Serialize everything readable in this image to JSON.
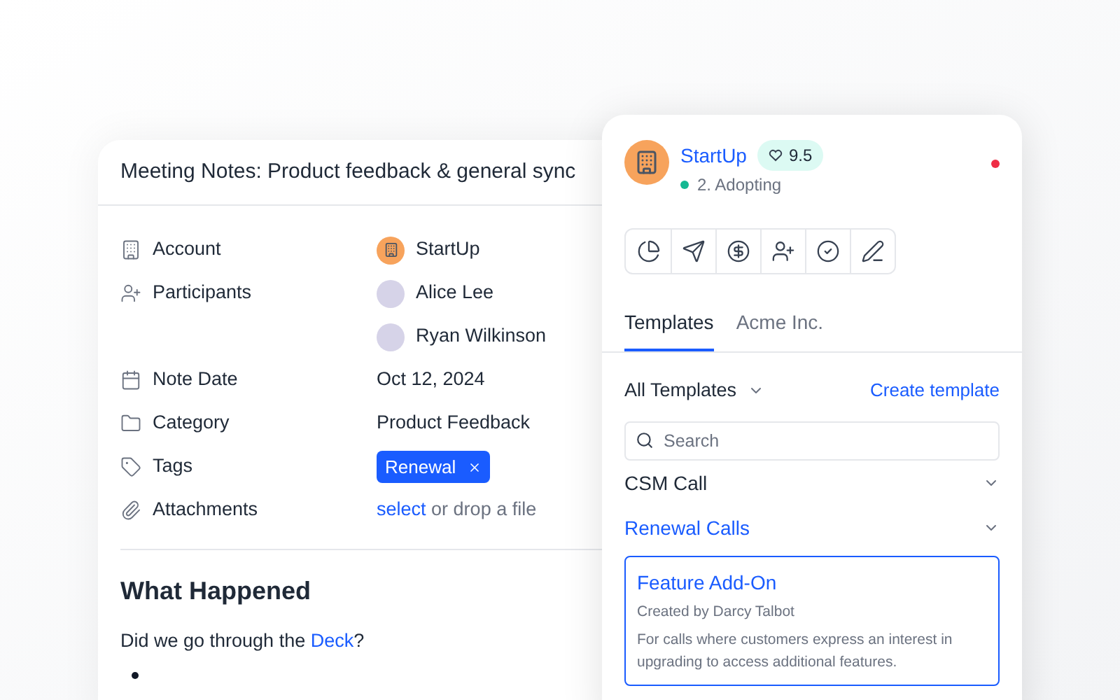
{
  "note": {
    "title": "Meeting Notes: Product feedback & general sync",
    "fields": [
      {
        "kind": "account",
        "label": "Account",
        "values": [
          "StartUp"
        ]
      },
      {
        "kind": "people",
        "label": "Participants",
        "values": [
          "Alice Lee",
          "Ryan Wilkinson"
        ]
      },
      {
        "kind": "date",
        "label": "Note Date",
        "values": [
          "Oct 12, 2024"
        ]
      },
      {
        "kind": "category",
        "label": "Category",
        "values": [
          "Product Feedback"
        ]
      },
      {
        "kind": "tags",
        "label": "Tags",
        "values": [
          "Renewal"
        ]
      },
      {
        "kind": "attachments",
        "label": "Attachments",
        "link": "select",
        "values": [
          "or drop a file"
        ]
      }
    ],
    "section_title": "What Happened",
    "question": {
      "before": "Did we go through the",
      "link": "Deck",
      "after": "?"
    }
  },
  "panel": {
    "account": "StartUp",
    "score": "9.5",
    "stage": "2. Adopting",
    "alert": true,
    "tabs": [
      {
        "label": "Templates",
        "selected": true
      },
      {
        "label": "Acme Inc.",
        "selected": false
      }
    ],
    "filter": "All Templates",
    "create": "Create template",
    "search": {
      "placeholder": "Search"
    },
    "groups": [
      {
        "label": "CSM Call",
        "expanded": false
      },
      {
        "label": "Renewal Calls",
        "expanded": true
      }
    ],
    "templates": [
      {
        "title": "Feature Add-On",
        "author": "Created by Darcy Talbot",
        "description": "For calls where customers express an interest in upgrading to access additional features.",
        "selected": true
      }
    ]
  }
}
